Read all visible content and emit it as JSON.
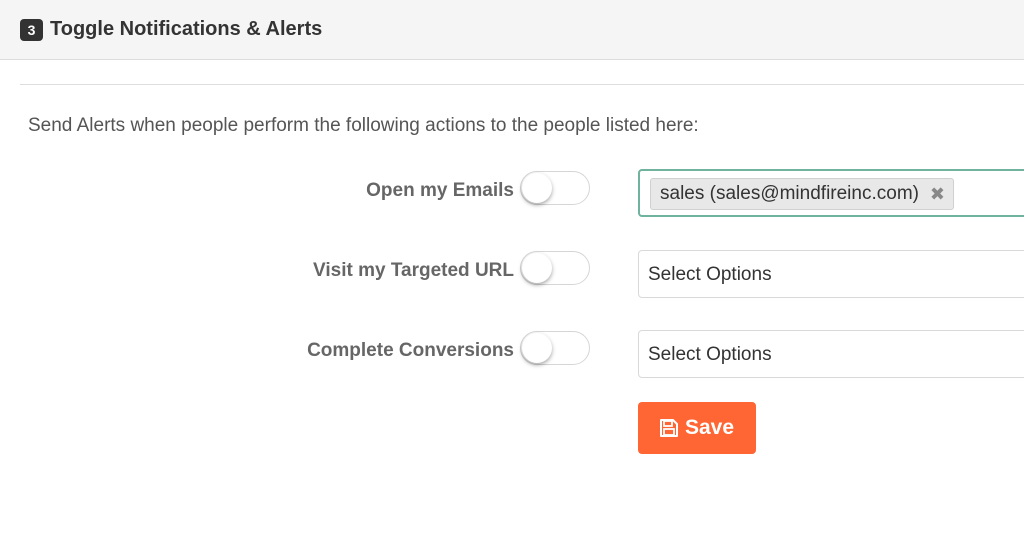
{
  "panel": {
    "step_number": "3",
    "title": "Toggle Notifications & Alerts"
  },
  "instructions": "Send Alerts when people perform the following actions to the people listed here:",
  "alerts": [
    {
      "label": "Open my Emails",
      "toggle_on": false,
      "recipients": [
        "sales (sales@mindfireinc.com)"
      ],
      "placeholder": ""
    },
    {
      "label": "Visit my Targeted URL",
      "toggle_on": false,
      "recipients": [],
      "placeholder": "Select Options"
    },
    {
      "label": "Complete Conversions",
      "toggle_on": false,
      "recipients": [],
      "placeholder": "Select Options"
    }
  ],
  "tag_remove_symbol": "✖",
  "save_button": {
    "label": "Save",
    "icon": "floppy-disk-icon",
    "color": "#ff6633"
  },
  "colors": {
    "focused_border": "#6fb39f",
    "header_bg": "#f5f5f5"
  }
}
